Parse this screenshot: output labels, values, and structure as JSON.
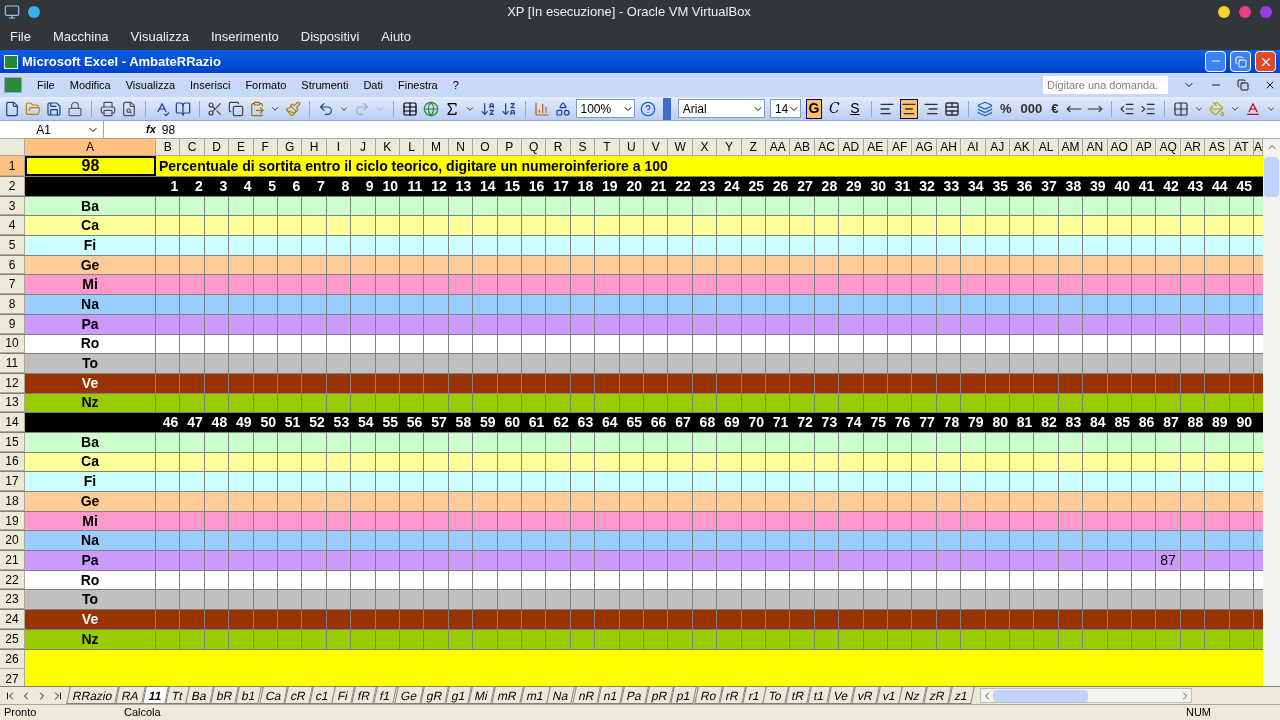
{
  "vm_window": {
    "title": "XP [In esecuzione] - Oracle VM VirtualBox",
    "menu": [
      "File",
      "Macchina",
      "Visualizza",
      "Inserimento",
      "Dispositivi",
      "Aiuto"
    ]
  },
  "excel": {
    "title": "Microsoft Excel - AmbateRRazio",
    "menu": [
      "File",
      "Modifica",
      "Visualizza",
      "Inserisci",
      "Formato",
      "Strumenti",
      "Dati",
      "Finestra",
      "?"
    ],
    "question_field": {
      "placeholder": "Digitare una domanda."
    },
    "toolbar": {
      "zoom": "100%",
      "font": "Arial",
      "size": "14",
      "format_buttons": [
        {
          "label": "G",
          "selected": true
        },
        {
          "label": "C",
          "selected": false
        },
        {
          "label": "S",
          "selected": false
        }
      ],
      "alignment": [
        {
          "kind": "left",
          "selected": false
        },
        {
          "kind": "center",
          "selected": true
        },
        {
          "kind": "right",
          "selected": false
        },
        {
          "kind": "merge",
          "selected": false
        }
      ],
      "number_buttons": [
        "%",
        "000",
        "€"
      ]
    },
    "formula_bar": {
      "cell": "A1",
      "fx": "fx",
      "value": "98"
    },
    "sheet": {
      "columns": [
        {
          "label": "A",
          "selected": true
        },
        {
          "label": "B",
          "selected": false
        },
        {
          "label": "C",
          "selected": false
        },
        {
          "label": "D",
          "selected": false
        },
        {
          "label": "E",
          "selected": false
        },
        {
          "label": "F",
          "selected": false
        },
        {
          "label": "G",
          "selected": false
        },
        {
          "label": "H",
          "selected": false
        },
        {
          "label": "I",
          "selected": false
        },
        {
          "label": "J",
          "selected": false
        },
        {
          "label": "K",
          "selected": false
        },
        {
          "label": "L",
          "selected": false
        },
        {
          "label": "M",
          "selected": false
        },
        {
          "label": "N",
          "selected": false
        },
        {
          "label": "O",
          "selected": false
        },
        {
          "label": "P",
          "selected": false
        },
        {
          "label": "Q",
          "selected": false
        },
        {
          "label": "R",
          "selected": false
        },
        {
          "label": "S",
          "selected": false
        },
        {
          "label": "T",
          "selected": false
        },
        {
          "label": "U",
          "selected": false
        },
        {
          "label": "V",
          "selected": false
        },
        {
          "label": "W",
          "selected": false
        },
        {
          "label": "X",
          "selected": false
        },
        {
          "label": "Y",
          "selected": false
        },
        {
          "label": "Z",
          "selected": false
        },
        {
          "label": "AA",
          "selected": false
        },
        {
          "label": "AB",
          "selected": false
        },
        {
          "label": "AC",
          "selected": false
        },
        {
          "label": "AD",
          "selected": false
        },
        {
          "label": "AE",
          "selected": false
        },
        {
          "label": "AF",
          "selected": false
        },
        {
          "label": "AG",
          "selected": false
        },
        {
          "label": "AH",
          "selected": false
        },
        {
          "label": "AI",
          "selected": false
        },
        {
          "label": "AJ",
          "selected": false
        },
        {
          "label": "AK",
          "selected": false
        },
        {
          "label": "AL",
          "selected": false
        },
        {
          "label": "AM",
          "selected": false
        },
        {
          "label": "AN",
          "selected": false
        },
        {
          "label": "AO",
          "selected": false
        },
        {
          "label": "AP",
          "selected": false
        },
        {
          "label": "AQ",
          "selected": false
        },
        {
          "label": "AR",
          "selected": false
        },
        {
          "label": "AS",
          "selected": false
        },
        {
          "label": "AT",
          "selected": false
        },
        {
          "label": "A",
          "selected": false
        }
      ],
      "rows": [
        {
          "number": "1",
          "selected": true,
          "kind": "title",
          "color": "#ffff00",
          "value": "98",
          "text": "Percentuale di sortita entro il ciclo teorico, digitare un numeroinferiore a 100"
        },
        {
          "number": "2",
          "selected": false,
          "kind": "numbers",
          "color": "#000000",
          "values": [
            "1",
            "2",
            "3",
            "4",
            "5",
            "6",
            "7",
            "8",
            "9",
            "10",
            "11",
            "12",
            "13",
            "14",
            "15",
            "16",
            "17",
            "18",
            "19",
            "20",
            "21",
            "22",
            "23",
            "24",
            "25",
            "26",
            "27",
            "28",
            "29",
            "30",
            "31",
            "32",
            "33",
            "34",
            "35",
            "36",
            "37",
            "38",
            "39",
            "40",
            "41",
            "42",
            "43",
            "44",
            "45"
          ]
        },
        {
          "number": "3",
          "selected": false,
          "kind": "group",
          "color": "#ccffcc",
          "label": "Ba"
        },
        {
          "number": "4",
          "selected": false,
          "kind": "group",
          "color": "#ffff99",
          "label": "Ca"
        },
        {
          "number": "5",
          "selected": false,
          "kind": "group",
          "color": "#ccffff",
          "label": "Fi"
        },
        {
          "number": "6",
          "selected": false,
          "kind": "group",
          "color": "#ffcc99",
          "label": "Ge"
        },
        {
          "number": "7",
          "selected": false,
          "kind": "group",
          "color": "#ff99cc",
          "label": "Mi"
        },
        {
          "number": "8",
          "selected": false,
          "kind": "group",
          "color": "#99ccff",
          "label": "Na"
        },
        {
          "number": "9",
          "selected": false,
          "kind": "group",
          "color": "#cc99ff",
          "label": "Pa"
        },
        {
          "number": "10",
          "selected": false,
          "kind": "group",
          "color": "#ffffff",
          "label": "Ro"
        },
        {
          "number": "11",
          "selected": false,
          "kind": "group",
          "color": "#c0c0c0",
          "label": "To"
        },
        {
          "number": "12",
          "selected": false,
          "kind": "group",
          "color": "#993300",
          "label": "Ve"
        },
        {
          "number": "13",
          "selected": false,
          "kind": "group",
          "color": "#99cc00",
          "label": "Nz"
        },
        {
          "number": "14",
          "selected": false,
          "kind": "numbers",
          "color": "#000000",
          "values": [
            "46",
            "47",
            "48",
            "49",
            "50",
            "51",
            "52",
            "53",
            "54",
            "55",
            "56",
            "57",
            "58",
            "59",
            "60",
            "61",
            "62",
            "63",
            "64",
            "65",
            "66",
            "67",
            "68",
            "69",
            "70",
            "71",
            "72",
            "73",
            "74",
            "75",
            "76",
            "77",
            "78",
            "79",
            "80",
            "81",
            "82",
            "83",
            "84",
            "85",
            "86",
            "87",
            "88",
            "89",
            "90"
          ]
        },
        {
          "number": "15",
          "selected": false,
          "kind": "group",
          "color": "#ccffcc",
          "label": "Ba"
        },
        {
          "number": "16",
          "selected": false,
          "kind": "group",
          "color": "#ffff99",
          "label": "Ca"
        },
        {
          "number": "17",
          "selected": false,
          "kind": "group",
          "color": "#ccffff",
          "label": "Fi"
        },
        {
          "number": "18",
          "selected": false,
          "kind": "group",
          "color": "#ffcc99",
          "label": "Ge"
        },
        {
          "number": "19",
          "selected": false,
          "kind": "group",
          "color": "#ff99cc",
          "label": "Mi"
        },
        {
          "number": "20",
          "selected": false,
          "kind": "group",
          "color": "#99ccff",
          "label": "Na"
        },
        {
          "number": "21",
          "selected": false,
          "kind": "group",
          "color": "#cc99ff",
          "label": "Pa",
          "cells": [
            null,
            null,
            null,
            null,
            null,
            null,
            null,
            null,
            null,
            null,
            null,
            null,
            null,
            null,
            null,
            null,
            null,
            null,
            null,
            null,
            null,
            null,
            null,
            null,
            null,
            null,
            null,
            null,
            null,
            null,
            null,
            null,
            null,
            null,
            null,
            null,
            null,
            null,
            null,
            null,
            null,
            "87",
            null,
            null,
            null
          ]
        },
        {
          "number": "22",
          "selected": false,
          "kind": "group",
          "color": "#ffffff",
          "label": "Ro"
        },
        {
          "number": "23",
          "selected": false,
          "kind": "group",
          "color": "#c0c0c0",
          "label": "To"
        },
        {
          "number": "24",
          "selected": false,
          "kind": "group",
          "color": "#993300",
          "label": "Ve"
        },
        {
          "number": "25",
          "selected": false,
          "kind": "group",
          "color": "#99cc00",
          "label": "Nz"
        },
        {
          "number": "26",
          "selected": false,
          "kind": "blank",
          "color": "#ffff00"
        },
        {
          "number": "27",
          "selected": false,
          "kind": "blank",
          "color": "#ffff00"
        }
      ]
    },
    "sheet_tabs": [
      {
        "label": "RRazio",
        "selected": false
      },
      {
        "label": "RA",
        "selected": false
      },
      {
        "label": "11",
        "selected": true
      },
      {
        "label": "Tt",
        "selected": false
      },
      {
        "label": "Ba",
        "selected": false
      },
      {
        "label": "bR",
        "selected": false
      },
      {
        "label": "b1",
        "selected": false
      },
      {
        "label": "Ca",
        "selected": false
      },
      {
        "label": "cR",
        "selected": false
      },
      {
        "label": "c1",
        "selected": false
      },
      {
        "label": "Fi",
        "selected": false
      },
      {
        "label": "fR",
        "selected": false
      },
      {
        "label": "f1",
        "selected": false
      },
      {
        "label": "Ge",
        "selected": false
      },
      {
        "label": "gR",
        "selected": false
      },
      {
        "label": "g1",
        "selected": false
      },
      {
        "label": "Mi",
        "selected": false
      },
      {
        "label": "mR",
        "selected": false
      },
      {
        "label": "m1",
        "selected": false
      },
      {
        "label": "Na",
        "selected": false
      },
      {
        "label": "nR",
        "selected": false
      },
      {
        "label": "n1",
        "selected": false
      },
      {
        "label": "Pa",
        "selected": false
      },
      {
        "label": "pR",
        "selected": false
      },
      {
        "label": "p1",
        "selected": false
      },
      {
        "label": "Ro",
        "selected": false
      },
      {
        "label": "rR",
        "selected": false
      },
      {
        "label": "r1",
        "selected": false
      },
      {
        "label": "To",
        "selected": false
      },
      {
        "label": "tR",
        "selected": false
      },
      {
        "label": "t1",
        "selected": false
      },
      {
        "label": "Ve",
        "selected": false
      },
      {
        "label": "vR",
        "selected": false
      },
      {
        "label": "v1",
        "selected": false
      },
      {
        "label": "Nz",
        "selected": false
      },
      {
        "label": "zR",
        "selected": false
      },
      {
        "label": "z1",
        "selected": false
      }
    ],
    "status_bar": {
      "left": "Pronto",
      "mode": "Calcola",
      "right": "NUM"
    }
  }
}
